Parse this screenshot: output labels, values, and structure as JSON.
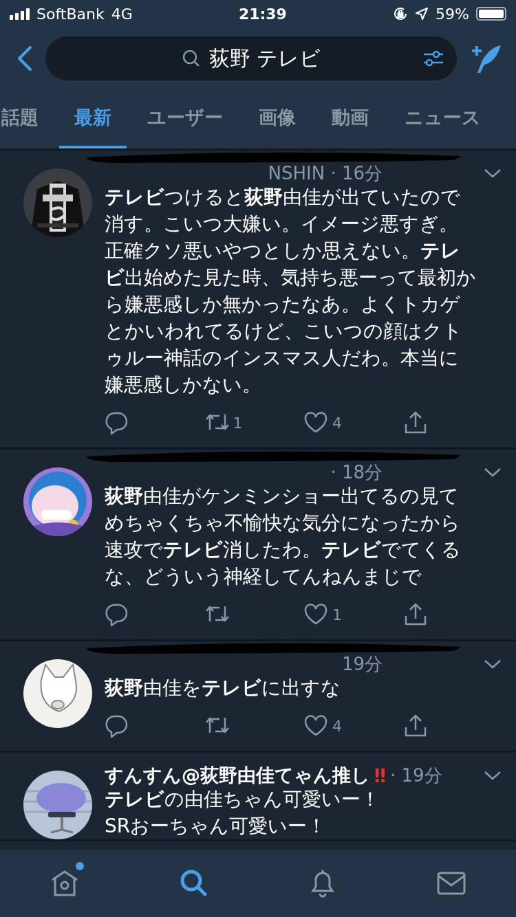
{
  "status_bar": {
    "carrier": "SoftBank",
    "network": "4G",
    "time": "21:39",
    "battery": "59%"
  },
  "search": {
    "query": "荻野 テレビ"
  },
  "tabs": [
    {
      "label": "話題",
      "selected": false
    },
    {
      "label": "最新",
      "selected": true
    },
    {
      "label": "ユーザー",
      "selected": false
    },
    {
      "label": "画像",
      "selected": false
    },
    {
      "label": "動画",
      "selected": false
    },
    {
      "label": "ニュース",
      "selected": false
    }
  ],
  "tweets": [
    {
      "redacted": true,
      "meta": "NSHIN · 16分",
      "text": "**テレビ**つけると**荻野**由佳が出ていたので消す。こいつ大嫌い。イメージ悪すぎ。正確クソ悪いやつとしか思えない。**テレビ**出始めた見た時、気持ち悪ーって最初から嫌悪感しか無かったなあ。よくトカゲとかいわれてるけど、こいつの顔はクトゥルー神話のインスマス人だわ。本当に嫌悪感しかない。",
      "retweets": "1",
      "likes": "4"
    },
    {
      "redacted": true,
      "meta": "· 18分",
      "text": "**荻野**由佳がケンミンショー出てるの見てめちゃくちゃ不愉快な気分になったから速攻で**テレビ**消したわ。**テレビ**でてくるな、どういう神経してんねんまじで",
      "likes": "1"
    },
    {
      "redacted": true,
      "meta": "19分",
      "text": "**荻野**由佳を**テレビ**に出すな",
      "likes": "4"
    },
    {
      "redacted": false,
      "name": "すんすん@荻野由佳てゃん推し",
      "name_mark": "‼",
      "meta": "· 19分",
      "text": "**テレビ**の由佳ちゃん可愛いー！\nSRおーちゃん可愛いー！"
    }
  ],
  "nav": [
    {
      "kind": "home",
      "selected": false,
      "unread": true
    },
    {
      "kind": "search",
      "selected": true,
      "unread": false
    },
    {
      "kind": "notifications",
      "selected": false,
      "unread": false
    },
    {
      "kind": "messages",
      "selected": false,
      "unread": false
    }
  ]
}
